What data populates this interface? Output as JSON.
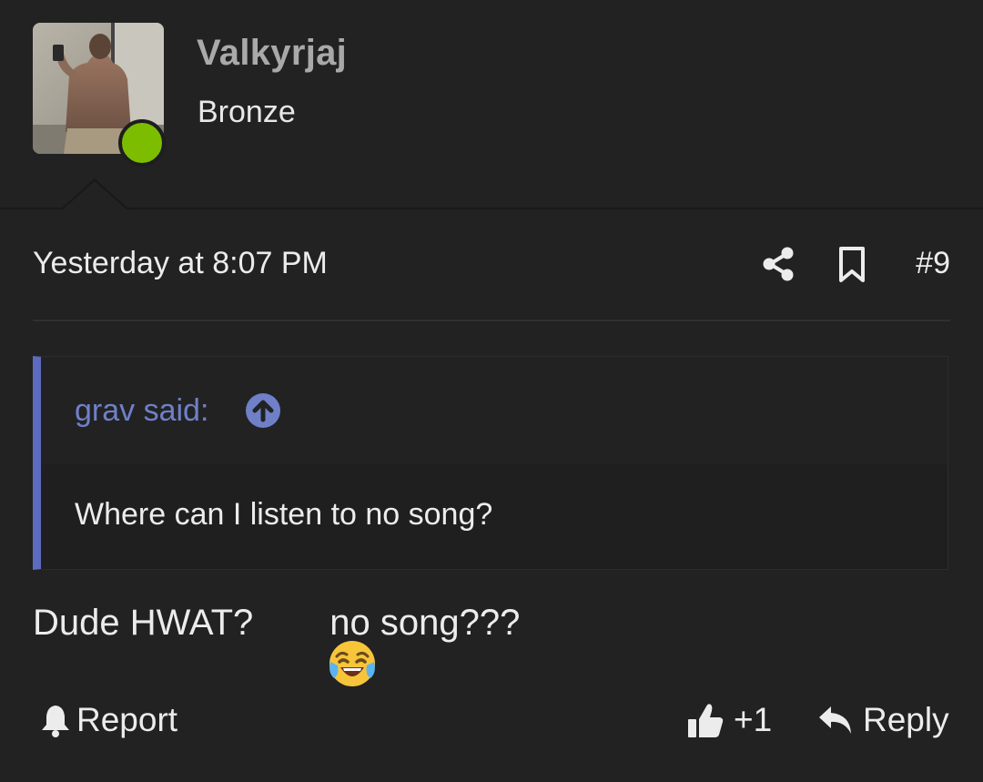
{
  "user": {
    "username": "Valkyrjaj",
    "title": "Bronze",
    "online": true,
    "online_color": "#7cbd00",
    "avatar_icon": "user-avatar-photo"
  },
  "meta": {
    "timestamp": "Yesterday at 8:07 PM",
    "share_icon": "share-icon",
    "bookmark_icon": "bookmark-icon",
    "post_number": "#9"
  },
  "quote": {
    "author_label": "grav said:",
    "jump_icon": "arrow-up-circle-icon",
    "text": "Where can I listen to no song?",
    "accent_color": "#5c6bc0"
  },
  "message": {
    "before_emoji": "Dude HWAT?",
    "emoji": "tears-of-joy",
    "after_emoji": "no song???"
  },
  "actions": {
    "report_label": "Report",
    "like_label": "+1",
    "reply_label": "Reply"
  }
}
